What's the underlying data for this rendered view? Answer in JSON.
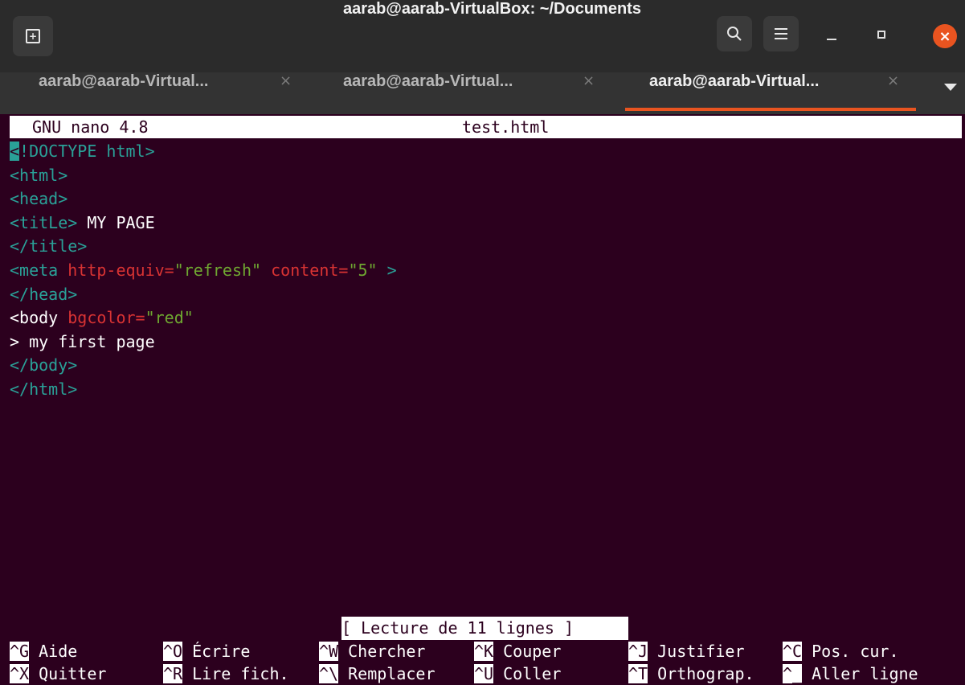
{
  "window": {
    "title": "aarab@aarab-VirtualBox: ~/Documents"
  },
  "tabs": [
    {
      "label": "aarab@aarab-Virtual...",
      "close": "×",
      "active": false
    },
    {
      "label": "aarab@aarab-Virtual...",
      "close": "×",
      "active": false
    },
    {
      "label": "aarab@aarab-Virtual...",
      "close": "×",
      "active": true
    }
  ],
  "icons": {
    "new_tab": "new-tab-icon",
    "search": "search-icon",
    "menu": "hamburger-menu-icon",
    "minimize": "minimize-icon",
    "maximize": "maximize-icon",
    "close": "close-icon",
    "tab_list": "chevron-down-icon"
  },
  "colors": {
    "terminal_bg": "#2c001e",
    "accent": "#e95420",
    "tag": "#2aa198",
    "attribute": "#d93333",
    "string": "#6fa831"
  },
  "nano": {
    "version": "GNU nano 4.8",
    "filename": "test.html",
    "lines": [
      [
        {
          "t": "<",
          "c": "cursor"
        },
        {
          "t": "!DOCTYPE html>",
          "c": "tag"
        }
      ],
      [
        {
          "t": "<html>",
          "c": "tag"
        }
      ],
      [
        {
          "t": "<head>",
          "c": "tag"
        }
      ],
      [
        {
          "t": "<titLe>",
          "c": "tag"
        },
        {
          "t": " MY PAGE",
          "c": "wht"
        }
      ],
      [
        {
          "t": "</title>",
          "c": "tag"
        }
      ],
      [
        {
          "t": "<meta",
          "c": "tag"
        },
        {
          "t": " http-equiv=",
          "c": "attr"
        },
        {
          "t": "\"refresh\"",
          "c": "str"
        },
        {
          "t": " content=",
          "c": "attr"
        },
        {
          "t": "\"5\"",
          "c": "str"
        },
        {
          "t": " >",
          "c": "tag"
        }
      ],
      [
        {
          "t": "</head>",
          "c": "tag"
        }
      ],
      [
        {
          "t": "<body",
          "c": "wht"
        },
        {
          "t": " bgcolor=",
          "c": "attr"
        },
        {
          "t": "\"red\"",
          "c": "str"
        }
      ],
      [
        {
          "t": "> my first page",
          "c": "wht"
        }
      ],
      [
        {
          "t": "</body>",
          "c": "tag"
        }
      ],
      [
        {
          "t": "</html>",
          "c": "tag"
        }
      ]
    ],
    "status": "[ Lecture de 11 lignes ]",
    "shortcuts": [
      {
        "key": "^G",
        "label": " Aide"
      },
      {
        "key": "^O",
        "label": " Écrire"
      },
      {
        "key": "^W",
        "label": " Chercher"
      },
      {
        "key": "^K",
        "label": " Couper"
      },
      {
        "key": "^J",
        "label": " Justifier"
      },
      {
        "key": "^C",
        "label": " Pos. cur."
      },
      {
        "key": "^X",
        "label": " Quitter"
      },
      {
        "key": "^R",
        "label": " Lire fich."
      },
      {
        "key": "^\\",
        "label": " Remplacer"
      },
      {
        "key": "^U",
        "label": " Coller"
      },
      {
        "key": "^T",
        "label": " Orthograp."
      },
      {
        "key": "^_",
        "label": " Aller ligne"
      }
    ]
  }
}
